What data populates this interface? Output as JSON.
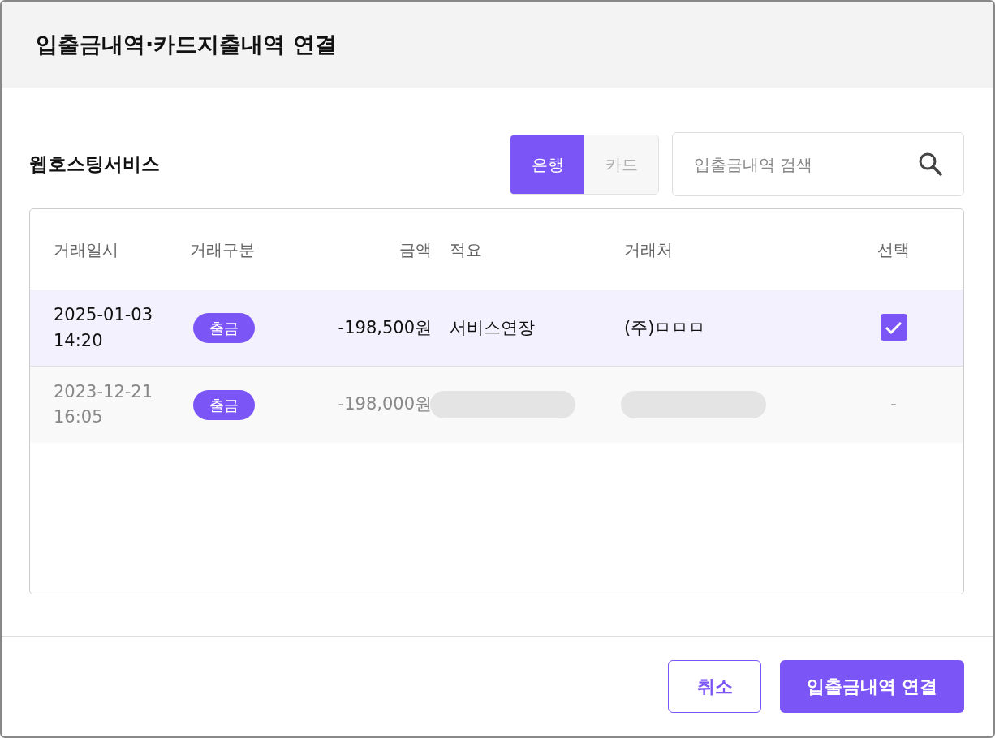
{
  "dialog": {
    "title": "입출금내역·카드지출내역 연결"
  },
  "section_title": "웹호스팅서비스",
  "source_tabs": [
    {
      "label": "은행",
      "selected": true
    },
    {
      "label": "카드",
      "selected": false
    }
  ],
  "search": {
    "placeholder": "입출금내역 검색"
  },
  "table": {
    "columns": [
      "거래일시",
      "거래구분",
      "금액",
      "적요",
      "거래처",
      "선택"
    ],
    "rows": [
      {
        "date": "2025-01-03",
        "time": "14:20",
        "type": "출금",
        "amount": "-198,500원",
        "memo": "서비스연장",
        "counterparty": "(주)ㅁㅁㅁ",
        "selected": true,
        "disabled": false,
        "select": {
          "kind": "checkbox",
          "checked": true
        }
      },
      {
        "date": "2023-12-21",
        "time": "16:05",
        "type": "출금",
        "amount": "-198,000원",
        "memo_hidden": true,
        "counterparty_hidden": true,
        "selected": false,
        "disabled": true,
        "select": {
          "kind": "text",
          "text": "-"
        }
      }
    ]
  },
  "buttons": [
    {
      "label": "취소",
      "kind": "outline"
    },
    {
      "label": "입출금내역 연결",
      "kind": "primary"
    }
  ]
}
